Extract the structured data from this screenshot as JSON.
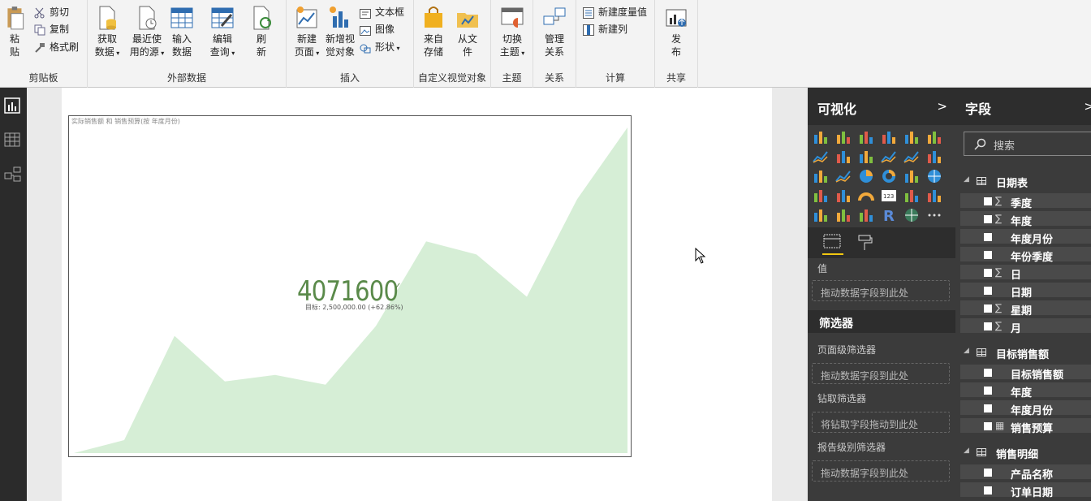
{
  "ribbon": {
    "groups": {
      "clipboard": "剪贴板",
      "external": "外部数据",
      "insert": "插入",
      "custom_visual": "自定义视觉对象",
      "theme": "主题",
      "relation": "关系",
      "calc": "计算",
      "share": "共享"
    },
    "paste": [
      "粘",
      "贴"
    ],
    "cut": "剪切",
    "copy": "复制",
    "format_painter": "格式刷",
    "get_data": [
      "获取",
      "数据"
    ],
    "recent_sources": [
      "最近使",
      "用的源"
    ],
    "enter_data": [
      "输入",
      "数据"
    ],
    "edit_queries": [
      "编辑",
      "查询"
    ],
    "refresh": [
      "刷",
      "新"
    ],
    "new_page": [
      "新建",
      "页面"
    ],
    "new_visual": [
      "新增视",
      "觉对象"
    ],
    "textbox": "文本框",
    "image": "图像",
    "shapes": "形状",
    "from_store": [
      "来自",
      "存储"
    ],
    "from_file": [
      "从文",
      "件"
    ],
    "switch_theme": [
      "切换",
      "主题"
    ],
    "manage_rel": [
      "管理",
      "关系"
    ],
    "new_measure": "新建度量值",
    "new_column": "新建列",
    "publish": [
      "发",
      "布"
    ]
  },
  "leftnav": {
    "icons": [
      "report-view-icon",
      "data-view-icon",
      "relationship-view-icon"
    ]
  },
  "visual": {
    "title": "实际销售额 和 销售预算(按 年度月份)",
    "kpi_value": "4071600",
    "kpi_goal": "目标: 2,500,000.00 (+62.86%)",
    "area_color": "#d6eed6",
    "kpi_color": "#5a8a4a"
  },
  "chart_data": {
    "type": "area",
    "series": [
      {
        "values": [
          0,
          0.04,
          0.36,
          0.22,
          0.24,
          0.21,
          0.39,
          0.65,
          0.61,
          0.48,
          0.78,
          1.0
        ]
      }
    ],
    "x": [
      1,
      2,
      3,
      4,
      5,
      6,
      7,
      8,
      9,
      10,
      11,
      12
    ],
    "ylim": [
      0,
      1
    ]
  },
  "viz_pane": {
    "title": "可视化",
    "values_label": "值",
    "drop_hint": "拖动数据字段到此处",
    "filters_title": "筛选器",
    "page_filters": "页面级筛选器",
    "page_drop": "拖动数据字段到此处",
    "drill_filters": "钻取筛选器",
    "drill_drop": "将钻取字段拖动到此处",
    "report_filters": "报告级别筛选器",
    "report_drop": "拖动数据字段到此处"
  },
  "fields_pane": {
    "title": "字段",
    "search_placeholder": "搜索",
    "tables": [
      {
        "name": "日期表",
        "fields": [
          {
            "name": "季度",
            "sigma": "∑"
          },
          {
            "name": "年度",
            "sigma": "∑"
          },
          {
            "name": "年度月份",
            "sigma": ""
          },
          {
            "name": "年份季度",
            "sigma": ""
          },
          {
            "name": "日",
            "sigma": "∑"
          },
          {
            "name": "日期",
            "sigma": ""
          },
          {
            "name": "星期",
            "sigma": "∑"
          },
          {
            "name": "月",
            "sigma": "∑"
          }
        ]
      },
      {
        "name": "目标销售额",
        "fields": [
          {
            "name": "目标销售额",
            "sigma": ""
          },
          {
            "name": "年度",
            "sigma": ""
          },
          {
            "name": "年度月份",
            "sigma": ""
          },
          {
            "name": "销售预算",
            "sigma": "▦"
          }
        ]
      },
      {
        "name": "销售明细",
        "fields": [
          {
            "name": "产品名称",
            "sigma": ""
          },
          {
            "name": "订单日期",
            "sigma": ""
          }
        ]
      }
    ]
  }
}
